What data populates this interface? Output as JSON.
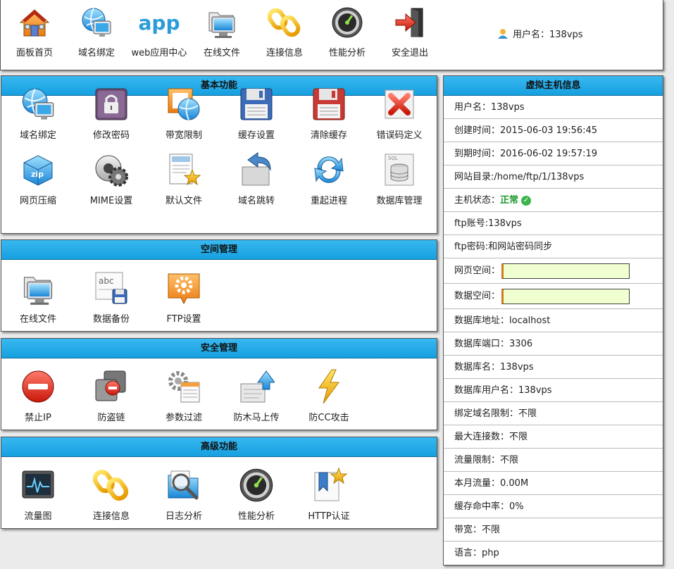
{
  "nav": {
    "items": [
      {
        "label": "面板首页",
        "icon": "house-icon"
      },
      {
        "label": "域名绑定",
        "icon": "globe-monitor-icon"
      },
      {
        "label": "web应用中心",
        "icon": "app-icon"
      },
      {
        "label": "在线文件",
        "icon": "folder-monitor-icon"
      },
      {
        "label": "连接信息",
        "icon": "chain-link-icon"
      },
      {
        "label": "性能分析",
        "icon": "gauge-icon"
      },
      {
        "label": "安全退出",
        "icon": "exit-door-icon"
      }
    ],
    "app_text": "app",
    "user_label": "用户名：138vps"
  },
  "basic": {
    "title": "基本功能",
    "items": [
      {
        "label": "域名绑定",
        "icon": "globe-monitor-icon"
      },
      {
        "label": "修改密码",
        "icon": "padlock-icon"
      },
      {
        "label": "带宽限制",
        "icon": "bandwidth-globe-icon"
      },
      {
        "label": "缓存设置",
        "icon": "floppy-blue-icon"
      },
      {
        "label": "清除缓存",
        "icon": "floppy-red-icon"
      },
      {
        "label": "错误码定义",
        "icon": "red-x-icon"
      },
      {
        "label": "网页压缩",
        "icon": "zip-box-icon"
      },
      {
        "label": "MIME设置",
        "icon": "gear-disc-icon"
      },
      {
        "label": "默认文件",
        "icon": "document-star-icon"
      },
      {
        "label": "域名跳转",
        "icon": "return-arrow-icon"
      },
      {
        "label": "重起进程",
        "icon": "refresh-icon"
      },
      {
        "label": "数据库管理",
        "icon": "database-icon"
      }
    ]
  },
  "space": {
    "title": "空间管理",
    "items": [
      {
        "label": "在线文件",
        "icon": "folder-monitor-icon"
      },
      {
        "label": "数据备份",
        "icon": "abc-backup-icon"
      },
      {
        "label": "FTP设置",
        "icon": "ftp-gear-icon"
      }
    ]
  },
  "security": {
    "title": "安全管理",
    "items": [
      {
        "label": "禁止IP",
        "icon": "no-entry-icon"
      },
      {
        "label": "防盗链",
        "icon": "anti-leech-icon"
      },
      {
        "label": "参数过滤",
        "icon": "gear-filter-icon"
      },
      {
        "label": "防木马上传",
        "icon": "upload-arrow-icon"
      },
      {
        "label": "防CC攻击",
        "icon": "lightning-icon"
      }
    ]
  },
  "advanced": {
    "title": "高级功能",
    "items": [
      {
        "label": "流量图",
        "icon": "monitor-wave-icon"
      },
      {
        "label": "连接信息",
        "icon": "chain-link-icon"
      },
      {
        "label": "日志分析",
        "icon": "magnifier-folder-icon"
      },
      {
        "label": "性能分析",
        "icon": "gauge-icon"
      },
      {
        "label": "HTTP认证",
        "icon": "bookmark-star-icon"
      }
    ]
  },
  "host": {
    "title": "虚拟主机信息",
    "username": "用户名：138vps",
    "created": "创建时间：2015-06-03 19:56:45",
    "expires": "到期时间：2016-06-02 19:57:19",
    "site_dir": "网站目录:/home/ftp/1/138vps",
    "status_label": "主机状态：",
    "status_value": "正常",
    "ftp_account": "ftp账号:138vps",
    "ftp_password": "ftp密码:和网站密码同步",
    "web_space_label": "网页空间：",
    "web_space_fraction": 0,
    "db_space_label": "数据空间：",
    "db_space_fraction": 0,
    "db_host": "数据库地址：localhost",
    "db_port": "数据库端口：3306",
    "db_name": "数据库名：138vps",
    "db_user": "数据库用户名：138vps",
    "domain_limit": "绑定域名限制：不限",
    "max_conn": "最大连接数：不限",
    "traffic_limit": "流量限制：不限",
    "month_traffic": "本月流量：0.00M",
    "cache_hit": "缓存命中率：0%",
    "bandwidth": "带宽：不限",
    "language": "语言：php"
  },
  "colors": {
    "header_blue": "#16a0e0",
    "bar_bg": "#efffd0",
    "bar_accent": "#d27a1e",
    "ok_green": "#1a9a2a"
  }
}
